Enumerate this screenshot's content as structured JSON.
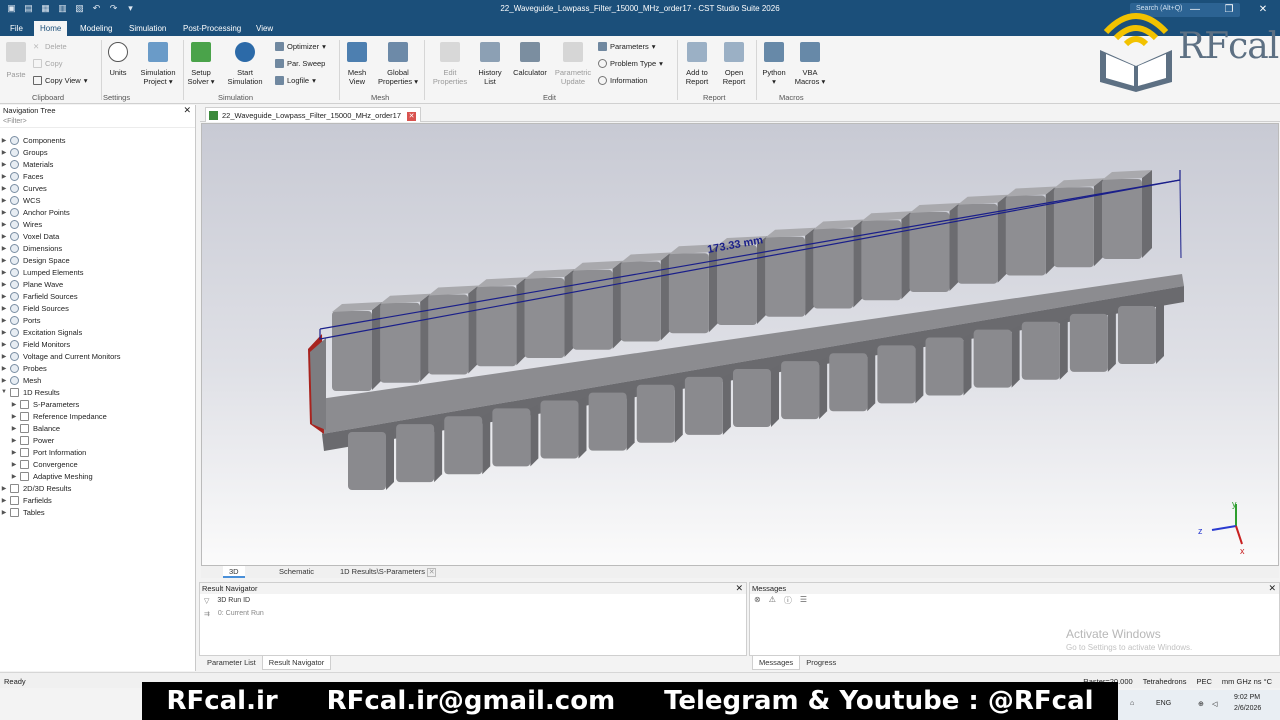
{
  "app": {
    "window_title": "22_Waveguide_Lowpass_Filter_15000_MHz_order17 - CST Studio Suite 2026",
    "search_placeholder": "Search (Alt+Q)"
  },
  "menu_tabs": [
    "File",
    "Home",
    "Modeling",
    "Simulation",
    "Post-Processing",
    "View"
  ],
  "active_tab": "Home",
  "ribbon": {
    "paste": "Paste",
    "delete": "Delete",
    "copy": "Copy",
    "copy_view": "Copy View",
    "clipboard_group": "Clipboard",
    "units": "Units",
    "sim_project": "Simulation",
    "sim_project2": "Project",
    "settings_group": "Settings",
    "setup_solver": "Setup",
    "setup_solver2": "Solver",
    "start_sim": "Start",
    "start_sim2": "Simulation",
    "optimizer": "Optimizer",
    "par_sweep": "Par. Sweep",
    "logfile": "Logfile",
    "simulation_group": "Simulation",
    "mesh_view": "Mesh",
    "mesh_view2": "View",
    "global_props": "Global",
    "global_props2": "Properties",
    "mesh_group": "Mesh",
    "edit_props": "Edit",
    "edit_props2": "Properties",
    "history_list": "History",
    "history_list2": "List",
    "calculator": "Calculator",
    "param_update": "Parametric",
    "param_update2": "Update",
    "parameters": "Parameters",
    "problem_type": "Problem Type",
    "information": "Information",
    "edit_group": "Edit",
    "add_report": "Add to",
    "add_report2": "Report",
    "open_report": "Open",
    "open_report2": "Report",
    "report_group": "Report",
    "python": "Python",
    "vba": "VBA",
    "vba2": "Macros",
    "macros_group": "Macros"
  },
  "nav": {
    "title": "Navigation Tree",
    "filter": "<Filter>",
    "items": [
      {
        "label": "Components",
        "level": 0,
        "icon": "globe"
      },
      {
        "label": "Groups",
        "level": 0,
        "icon": "globe"
      },
      {
        "label": "Materials",
        "level": 0,
        "icon": "globe"
      },
      {
        "label": "Faces",
        "level": 0,
        "icon": "globe"
      },
      {
        "label": "Curves",
        "level": 0,
        "icon": "globe"
      },
      {
        "label": "WCS",
        "level": 0,
        "icon": "globe"
      },
      {
        "label": "Anchor Points",
        "level": 0,
        "icon": "globe"
      },
      {
        "label": "Wires",
        "level": 0,
        "icon": "globe"
      },
      {
        "label": "Voxel Data",
        "level": 0,
        "icon": "globe"
      },
      {
        "label": "Dimensions",
        "level": 0,
        "icon": "globe"
      },
      {
        "label": "Design Space",
        "level": 0,
        "icon": "gear"
      },
      {
        "label": "Lumped Elements",
        "level": 0,
        "icon": "gear"
      },
      {
        "label": "Plane Wave",
        "level": 0,
        "icon": "gear"
      },
      {
        "label": "Farfield Sources",
        "level": 0,
        "icon": "gear"
      },
      {
        "label": "Field Sources",
        "level": 0,
        "icon": "gear"
      },
      {
        "label": "Ports",
        "level": 0,
        "icon": "gear"
      },
      {
        "label": "Excitation Signals",
        "level": 0,
        "icon": "gear"
      },
      {
        "label": "Field Monitors",
        "level": 0,
        "icon": "gear"
      },
      {
        "label": "Voltage and Current Monitors",
        "level": 0,
        "icon": "gear"
      },
      {
        "label": "Probes",
        "level": 0,
        "icon": "gear"
      },
      {
        "label": "Mesh",
        "level": 0,
        "icon": "gear"
      },
      {
        "label": "1D Results",
        "level": 0,
        "icon": "folder",
        "expanded": true
      },
      {
        "label": "S-Parameters",
        "level": 1,
        "icon": "folder"
      },
      {
        "label": "Reference Impedance",
        "level": 1,
        "icon": "folder"
      },
      {
        "label": "Balance",
        "level": 1,
        "icon": "folder"
      },
      {
        "label": "Power",
        "level": 1,
        "icon": "folder"
      },
      {
        "label": "Port Information",
        "level": 1,
        "icon": "folder"
      },
      {
        "label": "Convergence",
        "level": 1,
        "icon": "folder"
      },
      {
        "label": "Adaptive Meshing",
        "level": 1,
        "icon": "folder"
      },
      {
        "label": "2D/3D Results",
        "level": 0,
        "icon": "folder"
      },
      {
        "label": "Farfields",
        "level": 0,
        "icon": "folder"
      },
      {
        "label": "Tables",
        "level": 0,
        "icon": "folder"
      }
    ]
  },
  "doc_tab": "22_Waveguide_Lowpass_Filter_15000_MHz_order17",
  "view": {
    "dimension_label": "173.33 mm",
    "axis_y": "y",
    "axis_z": "z",
    "axis_x": "x",
    "tabs": [
      "3D",
      "Schematic",
      "1D Results\\S-Parameters"
    ]
  },
  "result_nav": {
    "title": "Result Navigator",
    "col": "3D Run ID",
    "row": "0: Current Run",
    "tabs": [
      "Parameter List",
      "Result Navigator"
    ]
  },
  "messages": {
    "title": "Messages",
    "tabs": [
      "Messages",
      "Progress"
    ]
  },
  "activate": {
    "line1": "Activate Windows",
    "line2": "Go to Settings to activate Windows."
  },
  "status": {
    "ready": "Ready",
    "raster": "Raster=20.000",
    "mesh": "Tetrahedrons",
    "bc": "PEC",
    "units": "mm  GHz  ns  °C"
  },
  "tray": {
    "lang": "ENG",
    "time": "9:02 PM",
    "date": "2/6/2026"
  },
  "banner": {
    "site": "RFcal.ir",
    "email": "RFcal.ir@gmail.com",
    "social": "Telegram & Youtube : @RFcal"
  },
  "logo": {
    "brand": "RFcal"
  }
}
